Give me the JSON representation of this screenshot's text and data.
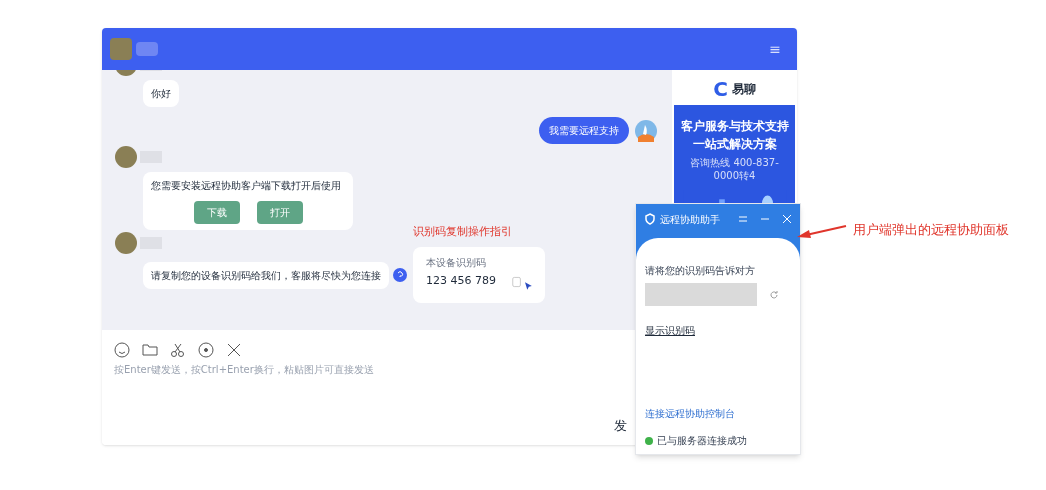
{
  "header": {
    "menu_icon": "≡"
  },
  "messages": [
    {
      "kind": "incoming",
      "text": "你好"
    },
    {
      "kind": "outgoing",
      "text": "我需要远程支持"
    },
    {
      "kind": "card",
      "text": "您需要安装远程协助客户端下载打开后使用",
      "buttons": [
        "下载",
        "打开"
      ]
    },
    {
      "kind": "identifier",
      "text": "请复制您的设备识别码给我们，客服将尽快为您连接",
      "note": "识别码复制操作指引",
      "id_label": "本设备识别码",
      "id_value": "123 456 789"
    }
  ],
  "toolbar": {
    "hint": "按Enter键发送，按Ctrl+Enter换行，粘贴图片可直接发送",
    "send": "发"
  },
  "sidebar": {
    "logo_mark": "C",
    "logo_text": "易聊",
    "banner_lines": [
      "客户服务与技术支持",
      "一站式解决方案",
      "咨询热线 400-837-0000转4"
    ]
  },
  "popup": {
    "title": "远程协助助手",
    "prompt": "请将您的识别码告诉对方",
    "link": "显示识别码",
    "footer_link": "连接远程协助控制台",
    "status": "已与服务器连接成功",
    "connected": true
  },
  "annotation": "用户端弹出的远程协助面板"
}
